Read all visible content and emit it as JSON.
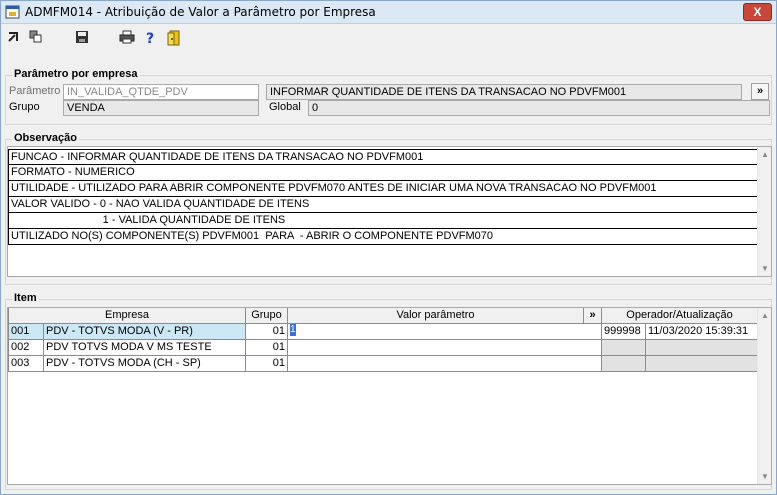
{
  "window": {
    "title": "ADMFM014 - Atribuição de Valor a Parâmetro por Empresa",
    "close_label": "X"
  },
  "toolbar": {
    "icons": [
      "arrow-in-icon",
      "copy-icon",
      "save-icon",
      "print-icon",
      "help-icon",
      "exit-door-icon"
    ],
    "help_glyph": "?"
  },
  "param_group": {
    "label": "Parâmetro por empresa",
    "parametro_label": "Parâmetro",
    "parametro_value": "IN_VALIDA_QTDE_PDV",
    "descricao_value": "INFORMAR QUANTIDADE DE ITENS DA TRANSACAO NO PDVFM001",
    "expand_label": "»",
    "grupo_label": "Grupo",
    "grupo_value": "VENDA",
    "global_label": "Global",
    "global_value": "0"
  },
  "obs_group": {
    "label": "Observação",
    "lines": [
      "FUNCAO - INFORMAR QUANTIDADE DE ITENS DA TRANSACAO NO PDVFM001",
      "FORMATO - NUMERICO",
      "UTILIDADE - UTILIZADO PARA ABRIR COMPONENTE PDVFM070 ANTES DE INICIAR UMA NOVA TRANSACAO NO PDVFM001",
      "VALOR VALIDO - 0 - NAO VALIDA QUANTIDADE DE ITENS",
      "                              1 - VALIDA QUANTIDADE DE ITENS",
      "UTILIZADO NO(S) COMPONENTE(S) PDVFM001  PARA  - ABRIR O COMPONENTE PDVFM070"
    ]
  },
  "item_group": {
    "label": "Item",
    "headers": {
      "empresa": "Empresa",
      "grupo": "Grupo",
      "valor": "Valor parâmetro",
      "expand": "»",
      "operador": "Operador/Atualização"
    },
    "rows": [
      {
        "code": "001",
        "empresa": "PDV - TOTVS MODA (V - PR)",
        "grupo": "01",
        "valor": "1",
        "operador": "999998",
        "atualizacao": "11/03/2020 15:39:31",
        "selected": true
      },
      {
        "code": "002",
        "empresa": "PDV TOTVS MODA V MS TESTE",
        "grupo": "01",
        "valor": "",
        "operador": "",
        "atualizacao": "",
        "selected": false
      },
      {
        "code": "003",
        "empresa": "PDV - TOTVS MODA (CH - SP)",
        "grupo": "01",
        "valor": "",
        "operador": "",
        "atualizacao": "",
        "selected": false
      }
    ]
  }
}
